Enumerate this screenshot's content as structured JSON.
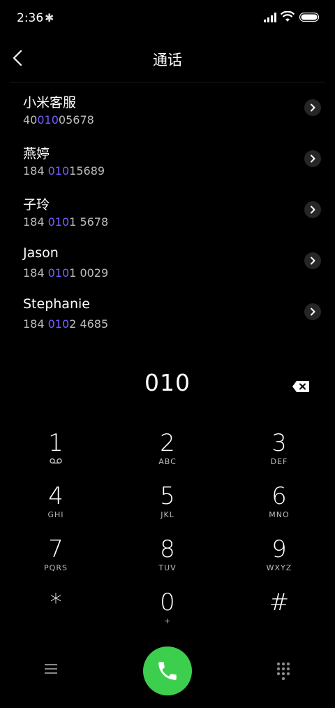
{
  "status": {
    "time": "2:36",
    "bluetooth": "✱"
  },
  "header": {
    "title": "通话"
  },
  "results": [
    {
      "name": "小米客服",
      "num_pre": "40",
      "num_hl": "010",
      "num_post": "05678"
    },
    {
      "name": "燕婷",
      "num_pre": "184 ",
      "num_hl": "010",
      "num_post": "15689"
    },
    {
      "name": "子玲",
      "num_pre": "184 ",
      "num_hl": "010",
      "num_post": "1 5678"
    },
    {
      "name": "Jason",
      "num_pre": "184 ",
      "num_hl": "010",
      "num_post": "1 0029"
    },
    {
      "name": "Stephanie",
      "num_pre": "184 ",
      "num_hl": "010",
      "num_post": "2 4685"
    }
  ],
  "display": {
    "digits": "010"
  },
  "keys": [
    {
      "d": "1",
      "l": ""
    },
    {
      "d": "2",
      "l": "ABC"
    },
    {
      "d": "3",
      "l": "DEF"
    },
    {
      "d": "4",
      "l": "GHI"
    },
    {
      "d": "5",
      "l": "JKL"
    },
    {
      "d": "6",
      "l": "MNO"
    },
    {
      "d": "7",
      "l": "PQRS"
    },
    {
      "d": "8",
      "l": "TUV"
    },
    {
      "d": "9",
      "l": "WXYZ"
    },
    {
      "d": "*",
      "l": ""
    },
    {
      "d": "0",
      "l": "+"
    },
    {
      "d": "#",
      "l": ""
    }
  ],
  "colors": {
    "accent": "#7a5cff",
    "call": "#3ccf4e",
    "background": "#000000"
  }
}
